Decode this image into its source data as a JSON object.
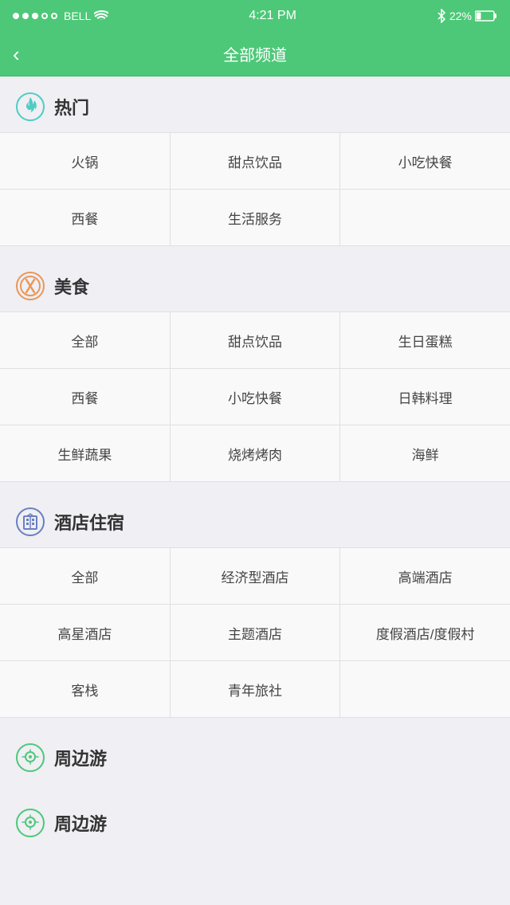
{
  "statusBar": {
    "carrier": "BELL",
    "time": "4:21 PM",
    "battery": "22%"
  },
  "navBar": {
    "title": "全部频道",
    "backLabel": "‹"
  },
  "sections": [
    {
      "id": "hot",
      "iconType": "hot",
      "title": "热门",
      "rows": [
        [
          "火锅",
          "甜点饮品",
          "小吃快餐"
        ],
        [
          "西餐",
          "生活服务",
          ""
        ]
      ]
    },
    {
      "id": "food",
      "iconType": "food",
      "title": "美食",
      "rows": [
        [
          "全部",
          "甜点饮品",
          "生日蛋糕"
        ],
        [
          "西餐",
          "小吃快餐",
          "日韩料理"
        ],
        [
          "生鲜蔬果",
          "烧烤烤肉",
          "海鲜"
        ]
      ]
    },
    {
      "id": "hotel",
      "iconType": "hotel",
      "title": "酒店住宿",
      "rows": [
        [
          "全部",
          "经济型酒店",
          "高端酒店"
        ],
        [
          "高星酒店",
          "主题酒店",
          "度假酒店/度假村"
        ],
        [
          "客栈",
          "青年旅社",
          ""
        ]
      ]
    },
    {
      "id": "travel",
      "iconType": "travel",
      "title": "周边游",
      "rows": []
    }
  ]
}
